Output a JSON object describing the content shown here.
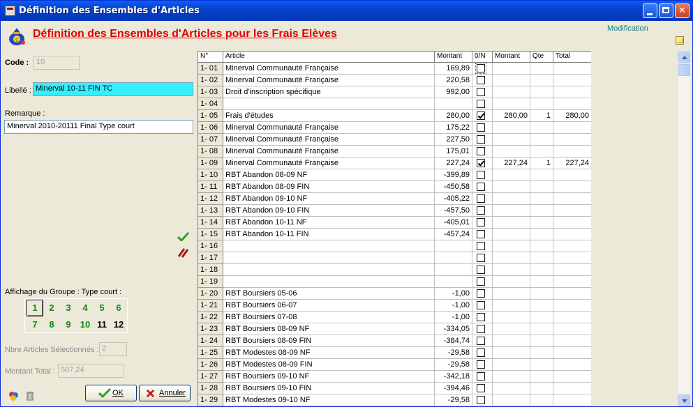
{
  "window": {
    "title": "Définition des Ensembles d'Articles"
  },
  "heading": "Définition des Ensembles d'Articles pour les Frais Elèves",
  "mode": "Modification",
  "form": {
    "code_label": "Code :",
    "code_value": "10",
    "libelle_label": "Libellé :",
    "libelle_value": "Minerval 10-11 FIN TC",
    "remarque_label": "Remarque :",
    "remarque_value": "Minerval 2010-20111 Final Type court",
    "group_label": "Affichage du Groupe : Type court :",
    "group_buttons": [
      "1",
      "2",
      "3",
      "4",
      "5",
      "6",
      "7",
      "8",
      "9",
      "10",
      "11",
      "12"
    ],
    "nbre_label": "Nbre Articles Sélectionnés :",
    "nbre_value": "2",
    "montant_label": "Montant Total :",
    "montant_value": "507,24",
    "ok_label": "OK",
    "cancel_label": "Annuler"
  },
  "grid": {
    "headers": [
      "N°",
      "Article",
      "Montant",
      "0/N",
      "Montant",
      "Qte",
      "Total"
    ],
    "rows": [
      {
        "n": "1- 01",
        "article": "Minerval Communauté Française",
        "montant": "169,89",
        "checked": false,
        "m2": "",
        "qte": "",
        "total": ""
      },
      {
        "n": "1- 02",
        "article": "Minerval Communauté Française",
        "montant": "220,58",
        "checked": false,
        "m2": "",
        "qte": "",
        "total": ""
      },
      {
        "n": "1- 03",
        "article": "Droit d'inscription spécifique",
        "montant": "992,00",
        "checked": false,
        "m2": "",
        "qte": "",
        "total": ""
      },
      {
        "n": "1- 04",
        "article": "",
        "montant": "",
        "checked": false,
        "m2": "",
        "qte": "",
        "total": ""
      },
      {
        "n": "1- 05",
        "article": "Frais d'études",
        "montant": "280,00",
        "checked": true,
        "m2": "280,00",
        "qte": "1",
        "total": "280,00"
      },
      {
        "n": "1- 06",
        "article": "Minerval Communauté Française",
        "montant": "175,22",
        "checked": false,
        "m2": "",
        "qte": "",
        "total": ""
      },
      {
        "n": "1- 07",
        "article": "Minerval Communauté Française",
        "montant": "227,50",
        "checked": false,
        "m2": "",
        "qte": "",
        "total": ""
      },
      {
        "n": "1- 08",
        "article": "Minerval Communauté Française",
        "montant": "175,01",
        "checked": false,
        "m2": "",
        "qte": "",
        "total": ""
      },
      {
        "n": "1- 09",
        "article": "Minerval Communauté Française",
        "montant": "227,24",
        "checked": true,
        "m2": "227,24",
        "qte": "1",
        "total": "227,24"
      },
      {
        "n": "1- 10",
        "article": "RBT Abandon 08-09 NF",
        "montant": "-399,89",
        "checked": false,
        "m2": "",
        "qte": "",
        "total": ""
      },
      {
        "n": "1- 11",
        "article": "RBT Abandon 08-09 FIN",
        "montant": "-450,58",
        "checked": false,
        "m2": "",
        "qte": "",
        "total": ""
      },
      {
        "n": "1- 12",
        "article": "RBT Abandon 09-10 NF",
        "montant": "-405,22",
        "checked": false,
        "m2": "",
        "qte": "",
        "total": ""
      },
      {
        "n": "1- 13",
        "article": "RBT Abandon 09-10 FIN",
        "montant": "-457,50",
        "checked": false,
        "m2": "",
        "qte": "",
        "total": ""
      },
      {
        "n": "1- 14",
        "article": "RBT Abandon 10-11 NF",
        "montant": "-405,01",
        "checked": false,
        "m2": "",
        "qte": "",
        "total": ""
      },
      {
        "n": "1- 15",
        "article": "RBT Abandon 10-11 FIN",
        "montant": "-457,24",
        "checked": false,
        "m2": "",
        "qte": "",
        "total": ""
      },
      {
        "n": "1- 16",
        "article": "",
        "montant": "",
        "checked": false,
        "m2": "",
        "qte": "",
        "total": ""
      },
      {
        "n": "1- 17",
        "article": "",
        "montant": "",
        "checked": false,
        "m2": "",
        "qte": "",
        "total": ""
      },
      {
        "n": "1- 18",
        "article": "",
        "montant": "",
        "checked": false,
        "m2": "",
        "qte": "",
        "total": ""
      },
      {
        "n": "1- 19",
        "article": "",
        "montant": "",
        "checked": false,
        "m2": "",
        "qte": "",
        "total": ""
      },
      {
        "n": "1- 20",
        "article": "RBT Boursiers 05-06",
        "montant": "-1,00",
        "checked": false,
        "m2": "",
        "qte": "",
        "total": ""
      },
      {
        "n": "1- 21",
        "article": "RBT Boursiers 06-07",
        "montant": "-1,00",
        "checked": false,
        "m2": "",
        "qte": "",
        "total": ""
      },
      {
        "n": "1- 22",
        "article": "RBT Boursiers 07-08",
        "montant": "-1,00",
        "checked": false,
        "m2": "",
        "qte": "",
        "total": ""
      },
      {
        "n": "1- 23",
        "article": "RBT Boursiers 08-09 NF",
        "montant": "-334,05",
        "checked": false,
        "m2": "",
        "qte": "",
        "total": ""
      },
      {
        "n": "1- 24",
        "article": "RBT Boursiers 08-09 FIN",
        "montant": "-384,74",
        "checked": false,
        "m2": "",
        "qte": "",
        "total": ""
      },
      {
        "n": "1- 25",
        "article": "RBT Modestes 08-09 NF",
        "montant": "-29,58",
        "checked": false,
        "m2": "",
        "qte": "",
        "total": ""
      },
      {
        "n": "1- 26",
        "article": "RBT Modestes 08-09 FIN",
        "montant": "-29,58",
        "checked": false,
        "m2": "",
        "qte": "",
        "total": ""
      },
      {
        "n": "1- 27",
        "article": "RBT Boursiers 09-10 NF",
        "montant": "-342,18",
        "checked": false,
        "m2": "",
        "qte": "",
        "total": ""
      },
      {
        "n": "1- 28",
        "article": "RBT Boursiers 09-10 FIN",
        "montant": "-394,46",
        "checked": false,
        "m2": "",
        "qte": "",
        "total": ""
      },
      {
        "n": "1- 29",
        "article": "RBT Modestes 09-10 NF",
        "montant": "-29,58",
        "checked": false,
        "m2": "",
        "qte": "",
        "total": ""
      }
    ]
  },
  "icons": {
    "app": "app-icon",
    "heading": "money-bag-icon",
    "validate": "checkmark-icon",
    "cancel_marks": "slash-icon",
    "ok": "ok-check-icon",
    "annuler": "x-icon",
    "bottom_left": [
      "settings-icon",
      "trash-icon"
    ],
    "corner": "grid-icon"
  },
  "colors": {
    "heading": "#e00000",
    "libelle_bg": "#33f0ff",
    "group_text": "#138a13",
    "mode_text": "#118080"
  }
}
